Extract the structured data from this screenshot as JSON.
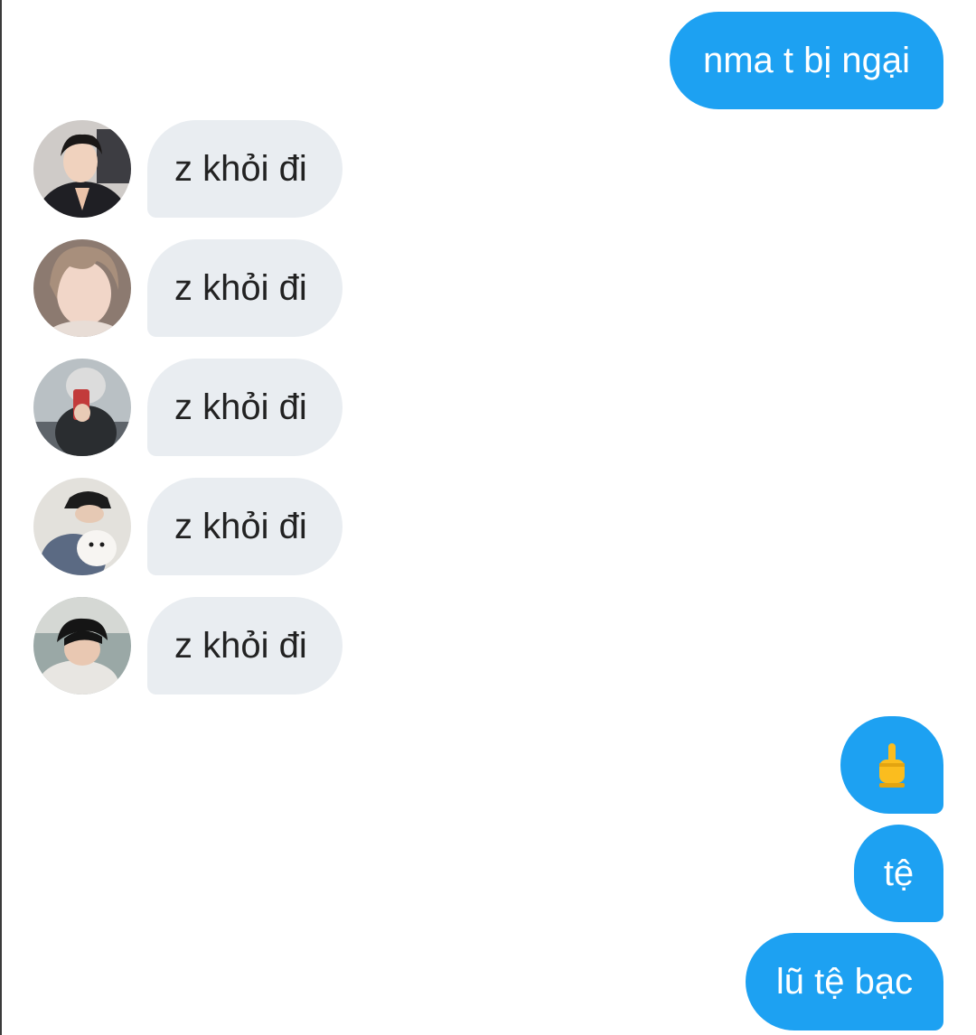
{
  "chat": {
    "outgoing_1": {
      "text": "nma t bị ngại"
    },
    "incoming": [
      {
        "text": "z khỏi đi",
        "avatar_icon": "person-avatar-1"
      },
      {
        "text": "z khỏi đi",
        "avatar_icon": "person-avatar-2"
      },
      {
        "text": "z khỏi đi",
        "avatar_icon": "person-avatar-3"
      },
      {
        "text": "z khỏi đi",
        "avatar_icon": "person-avatar-4"
      },
      {
        "text": "z khỏi đi",
        "avatar_icon": "person-avatar-5"
      }
    ],
    "outgoing_2": {
      "emoji": "🖕",
      "icon": "middle-finger-emoji"
    },
    "outgoing_3": {
      "text": "tệ"
    },
    "outgoing_4": {
      "text": "lũ tệ bạc"
    }
  },
  "colors": {
    "sent_bubble": "#1da1f2",
    "received_bubble": "#e9edf1",
    "sent_text": "#ffffff",
    "received_text": "#222222"
  }
}
